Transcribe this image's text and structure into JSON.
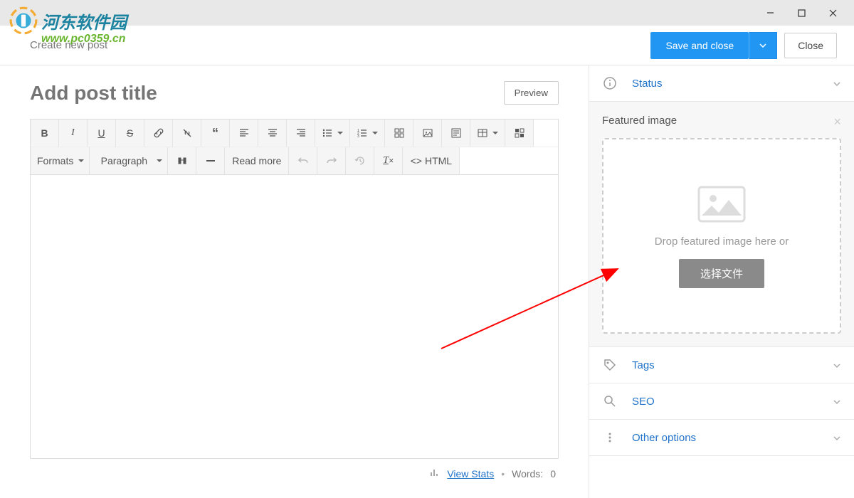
{
  "watermark": {
    "text1": "河东软件园",
    "text2": "www.pc0359.cn"
  },
  "header": {
    "title": "Create new post",
    "save": "Save and close",
    "close": "Close"
  },
  "editor": {
    "title_placeholder": "Add post title",
    "preview": "Preview",
    "formats_label": "Formats",
    "paragraph_label": "Paragraph",
    "readmore_label": "Read more",
    "html_label": "HTML"
  },
  "footer": {
    "stats": "View Stats",
    "words_label": "Words:",
    "words_value": "0"
  },
  "sidebar": {
    "status": "Status",
    "featured": {
      "title": "Featured image",
      "drop_text": "Drop featured image here or",
      "button": "选择文件"
    },
    "tags": "Tags",
    "seo": "SEO",
    "other": "Other options"
  }
}
